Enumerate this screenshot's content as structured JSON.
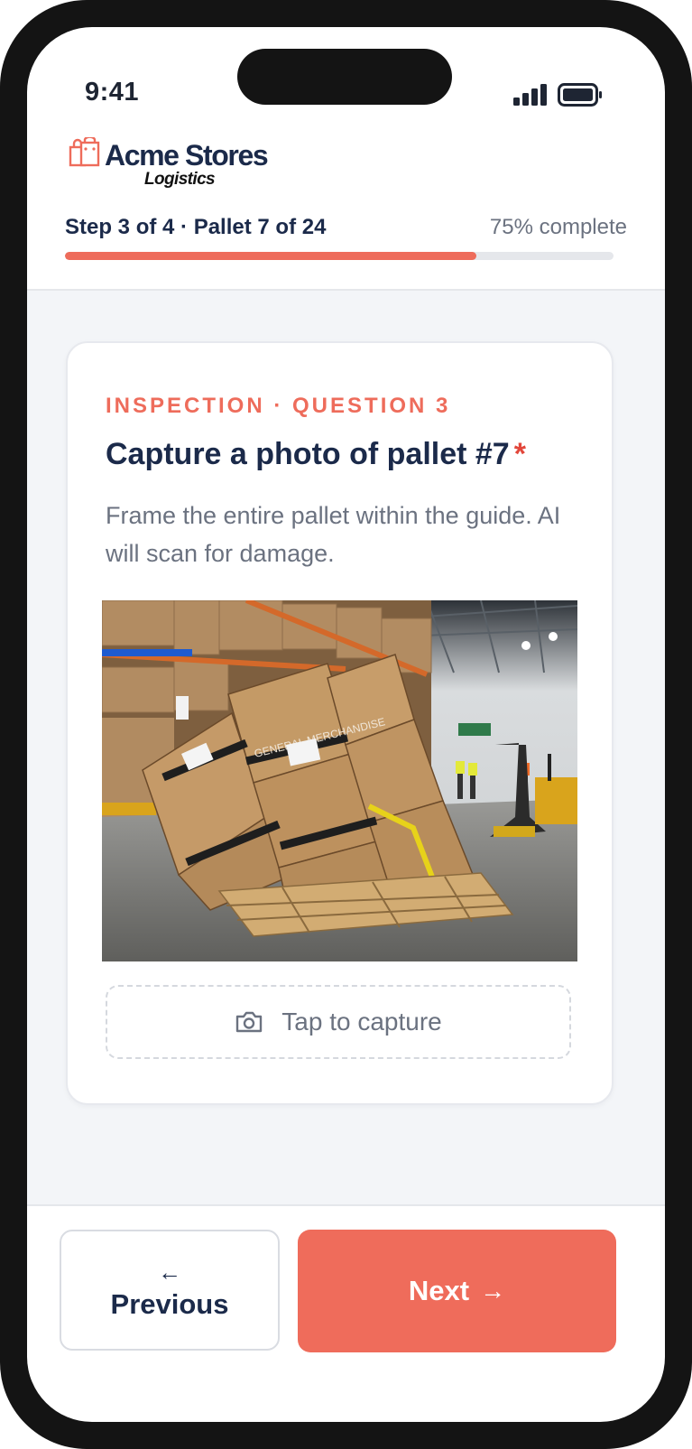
{
  "status_bar": {
    "time": "9:41"
  },
  "brand": {
    "name": "Acme Stores",
    "subtitle": "Logistics",
    "accent_color": "#ee6c5b",
    "logo_icon": "shopping-bags-icon"
  },
  "progress": {
    "label": "Step 3 of 4 · Pallet 7 of 24",
    "percent_text": "75% complete",
    "fraction": 0.75
  },
  "question": {
    "eyebrow": "INSPECTION · QUESTION 3",
    "title": "Capture a photo of pallet #7",
    "required_mark": "*",
    "description": "Frame the entire pallet within the guide. AI will scan for damage.",
    "photo_box_label": "GENERAL MERCHANDISE"
  },
  "capture": {
    "label": "Tap to capture",
    "icon": "camera-icon"
  },
  "nav": {
    "previous_arrow": "←",
    "previous_label": "Previous",
    "next_label": "Next",
    "next_arrow": "→"
  }
}
